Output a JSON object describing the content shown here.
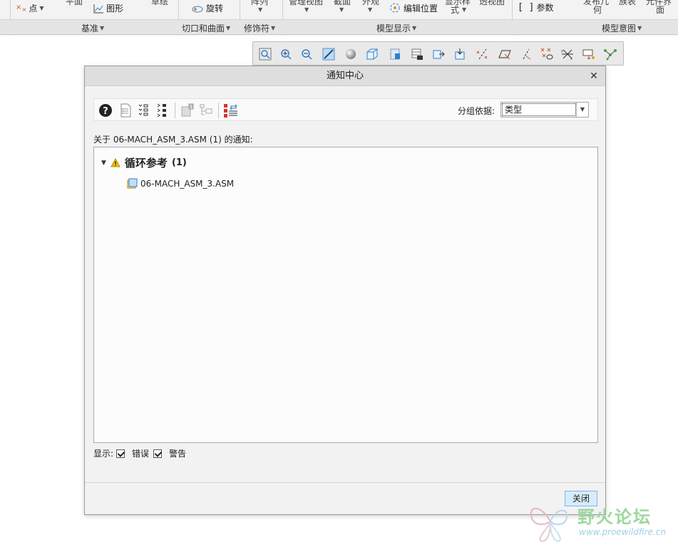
{
  "ribbon": {
    "items": {
      "point": "点",
      "graph": "图形",
      "revolve": "旋转",
      "edit_position": "编辑位置",
      "parameters": "参数"
    },
    "partial_top": {
      "a": "平面",
      "b": "草绘",
      "c": "阵列",
      "d": "管理视图",
      "e": "截面",
      "f": "外观",
      "g": "显示样",
      "h": "透视图",
      "i": "发布几",
      "j": "族表",
      "k": "元件界"
    },
    "partial_bottom": {
      "g2": "式",
      "i2": "何",
      "k2": "面"
    },
    "groups": {
      "datum": "基准",
      "cut_surface": "切口和曲面",
      "cosmetic": "修饰符",
      "model_display": "模型显示",
      "model_intent": "模型意图"
    }
  },
  "dialog": {
    "title": "通知中心",
    "group_by_label": "分组依据:",
    "group_by_value": "类型",
    "notif_header": "关于 06-MACH_ASM_3.ASM (1) 的通知:",
    "category": {
      "label": "循环参考",
      "count": "(1)",
      "items": [
        "06-MACH_ASM_3.ASM"
      ]
    },
    "show": {
      "label": "显示:",
      "errors": "错误",
      "warnings": "警告"
    },
    "close_button": "关闭"
  },
  "watermark": {
    "text": "野火论坛",
    "url": "www.proewildfire.cn"
  },
  "colors": {
    "warning": "#f5c400",
    "accent_blue": "#2f7fd0",
    "close_button_bg": "#d7ecfb"
  }
}
